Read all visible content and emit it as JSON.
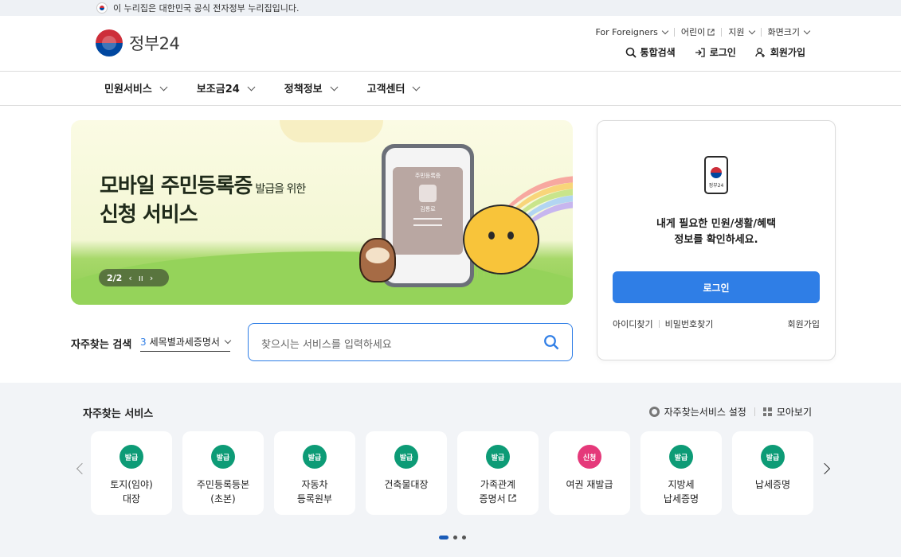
{
  "top_notice": "이 누리집은 대한민국 공식 전자정부 누리집입니다.",
  "logo": {
    "text": "정부24"
  },
  "util_menu": [
    {
      "label": "For Foreigners",
      "icon": "chevron-down-icon"
    },
    {
      "label": "어린이",
      "icon": "external-link-icon"
    },
    {
      "label": "지원",
      "icon": "chevron-down-icon"
    },
    {
      "label": "화면크기",
      "icon": "chevron-down-icon"
    }
  ],
  "actions": {
    "search": "통합검색",
    "login": "로그인",
    "signup": "회원가입"
  },
  "gnb": [
    "민원서비스",
    "보조금24",
    "정책정보",
    "고객센터"
  ],
  "banner": {
    "title_main": "모바일 주민등록증",
    "title_sub": "발급을 위한",
    "title_line2": "신청 서비스",
    "phone_card_title": "주민등록증",
    "phone_card_name": "김통로",
    "pager": "2/2"
  },
  "search": {
    "label": "자주찾는 검색",
    "keyword_rank": "3",
    "keyword": "세목별과세증명서",
    "placeholder": "찾으시는 서비스를 입력하세요"
  },
  "login_panel": {
    "device_label": "정부24",
    "message_line1": "내게 필요한 민원/생활/혜택",
    "message_line2": "정보를 확인하세요.",
    "login_button": "로그인",
    "find_id": "아이디찾기",
    "find_pw": "비밀번호찾기",
    "signup": "회원가입"
  },
  "services": {
    "title": "자주찾는 서비스",
    "settings": "자주찾는서비스 설정",
    "view_all": "모아보기",
    "cards": [
      {
        "badge": "발급",
        "line1": "토지(임야)",
        "line2": "대장",
        "type": "issue"
      },
      {
        "badge": "발급",
        "line1": "주민등록등본",
        "line2": "(초본)",
        "type": "issue"
      },
      {
        "badge": "발급",
        "line1": "자동차",
        "line2": "등록원부",
        "type": "issue"
      },
      {
        "badge": "발급",
        "line1": "건축물대장",
        "line2": "",
        "type": "issue"
      },
      {
        "badge": "발급",
        "line1": "가족관계",
        "line2": "증명서",
        "type": "issue",
        "external": true
      },
      {
        "badge": "신청",
        "line1": "여권 재발급",
        "line2": "",
        "type": "apply"
      },
      {
        "badge": "발급",
        "line1": "지방세",
        "line2": "납세증명",
        "type": "issue"
      },
      {
        "badge": "발급",
        "line1": "납세증명",
        "line2": "",
        "type": "issue"
      }
    ]
  },
  "colors": {
    "accent": "#2f7ee6",
    "issue_badge": "#0d9b76",
    "apply_badge": "#e5397a",
    "nav_dot_active": "#1a5bb8"
  }
}
